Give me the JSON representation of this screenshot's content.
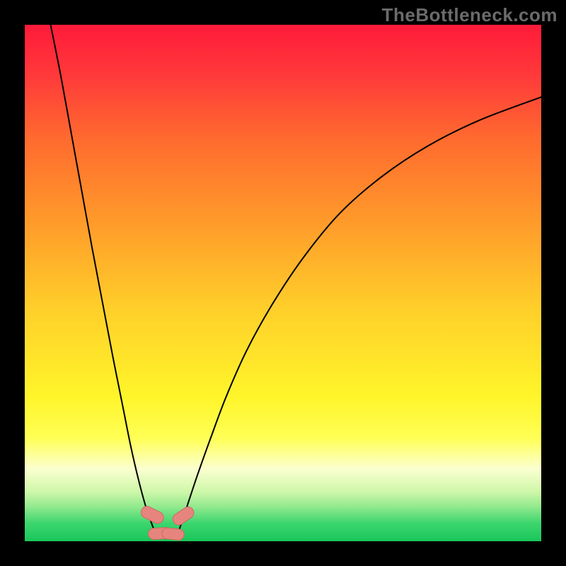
{
  "watermark": "TheBottleneck.com",
  "colors": {
    "frame": "#000000",
    "curve_stroke": "#000000",
    "marker_fill": "#e6857d",
    "marker_stroke": "#cc6a62"
  },
  "gradient_stops": [
    {
      "offset": 0.0,
      "color": "#ff1a3a"
    },
    {
      "offset": 0.1,
      "color": "#ff3a3a"
    },
    {
      "offset": 0.22,
      "color": "#ff6a2f"
    },
    {
      "offset": 0.38,
      "color": "#ff9a2a"
    },
    {
      "offset": 0.55,
      "color": "#ffcf2a"
    },
    {
      "offset": 0.72,
      "color": "#fff52a"
    },
    {
      "offset": 0.8,
      "color": "#ffff55"
    },
    {
      "offset": 0.86,
      "color": "#fbffd0"
    },
    {
      "offset": 0.905,
      "color": "#cdf7a8"
    },
    {
      "offset": 0.935,
      "color": "#8de88c"
    },
    {
      "offset": 0.965,
      "color": "#3cd66e"
    },
    {
      "offset": 1.0,
      "color": "#19c75a"
    }
  ],
  "chart_data": {
    "type": "line",
    "title": "",
    "xlabel": "",
    "ylabel": "",
    "xlim": [
      0,
      100
    ],
    "ylim": [
      0,
      100
    ],
    "series": [
      {
        "name": "left-branch",
        "x": [
          5,
          7,
          9,
          11,
          13,
          15,
          17,
          19,
          20.5,
          22,
          23.5,
          25,
          25.8
        ],
        "y": [
          100,
          90,
          79,
          68,
          57,
          46.5,
          36,
          26,
          18.5,
          12,
          6.5,
          2.3,
          0.5
        ]
      },
      {
        "name": "right-branch",
        "x": [
          29.2,
          30,
          31.5,
          33.5,
          36,
          39,
          43,
          48,
          54,
          61,
          69,
          78,
          88,
          100
        ],
        "y": [
          0.5,
          2.5,
          7,
          13,
          20,
          28,
          37,
          46,
          55,
          63.5,
          70.5,
          76.5,
          81.5,
          86
        ]
      }
    ],
    "markers": [
      {
        "x": 24.7,
        "y": 5.1,
        "w": 2.3,
        "h": 4.6,
        "angle": -64
      },
      {
        "x": 26.1,
        "y": 1.5,
        "w": 4.4,
        "h": 2.2,
        "angle": -4
      },
      {
        "x": 28.7,
        "y": 1.4,
        "w": 4.3,
        "h": 2.15,
        "angle": 6
      },
      {
        "x": 30.7,
        "y": 4.9,
        "w": 2.25,
        "h": 4.45,
        "angle": 56
      }
    ]
  }
}
